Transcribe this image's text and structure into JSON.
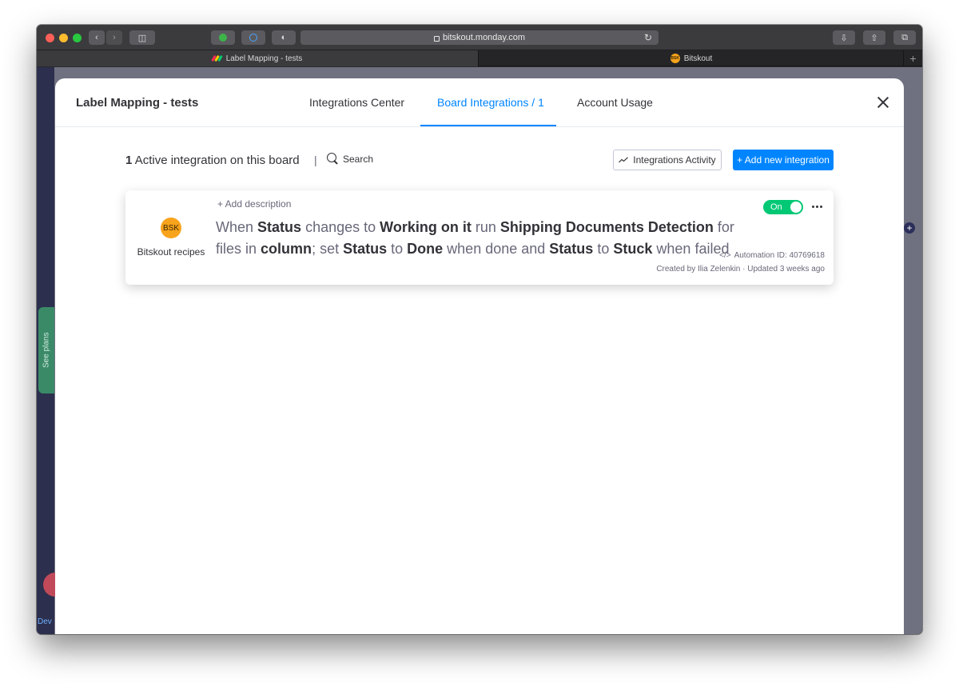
{
  "browser": {
    "url": "bitskout.monday.com",
    "tabs": [
      {
        "title": "Label Mapping - tests",
        "active": true
      },
      {
        "title": "Bitskout",
        "active": false
      }
    ]
  },
  "background": {
    "see_plans": "See plans",
    "dev_label": "Dev"
  },
  "modal": {
    "board_title": "Label Mapping - tests",
    "nav": {
      "integrations_center": "Integrations Center",
      "board_integrations": "Board Integrations / 1",
      "account_usage": "Account Usage"
    },
    "active_count": "1",
    "active_text": "Active integration on this board",
    "separator": "|",
    "search_label": "Search",
    "activity_button": "Integrations Activity",
    "add_button": "+ Add new integration",
    "integration": {
      "logo_text": "BSK",
      "app_name": "Bitskout recipes",
      "add_description": "+ Add description",
      "sentence": {
        "w1": "When",
        "b1": "Status",
        "w2": "changes to",
        "b2": "Working on it",
        "w3": "run",
        "b3": "Shipping Documents Detection",
        "w4": "for files in",
        "b4": "column",
        "w5": "; set",
        "b5": "Status",
        "w6": "to",
        "b6": "Done",
        "w7": "when done and",
        "b7": "Status",
        "w8": "to",
        "b8": "Stuck",
        "w9": "when failed"
      },
      "toggle_label": "On",
      "automation_id": "Automation ID: 40769618",
      "created_line": "Created by Ilia Zelenkin · Updated 3 weeks ago"
    }
  },
  "colors": {
    "accent": "#0085ff",
    "toggle_on": "#00c875",
    "bsk_orange": "#f7a31c"
  }
}
